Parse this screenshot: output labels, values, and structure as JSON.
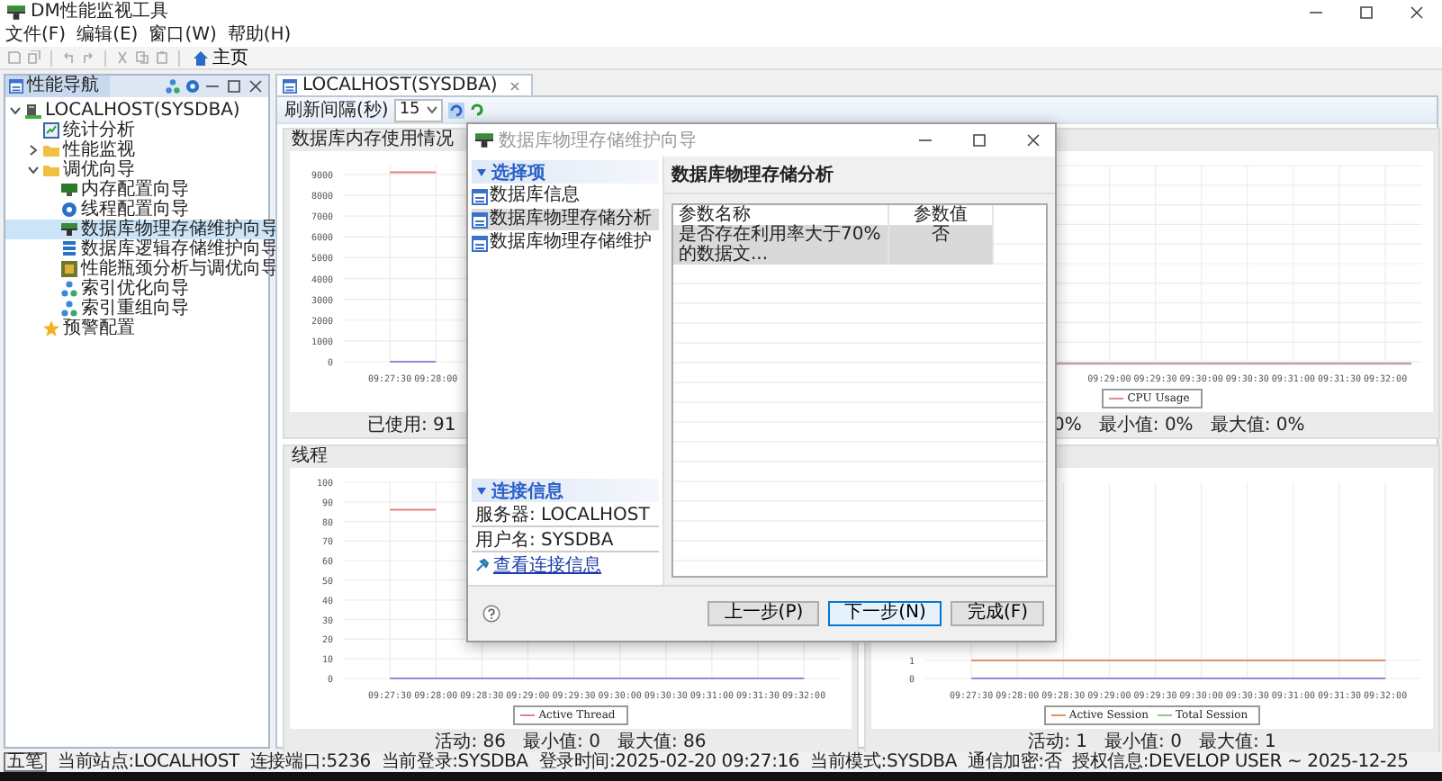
{
  "window": {
    "title": "DM性能监视工具"
  },
  "menu": [
    "文件(F)",
    "编辑(E)",
    "窗口(W)",
    "帮助(H)"
  ],
  "toolbar": {
    "home": "主页"
  },
  "navigator": {
    "title": "性能导航",
    "tree": [
      {
        "label": "LOCALHOST(SYSDBA)",
        "kind": "server",
        "expanded": true,
        "selected": false,
        "children": [
          {
            "label": "统计分析",
            "kind": "chart",
            "selected": false
          },
          {
            "label": "性能监视",
            "kind": "folder",
            "expanded": false,
            "selected": false
          },
          {
            "label": "调优向导",
            "kind": "folder",
            "expanded": true,
            "selected": false,
            "children": [
              {
                "label": "内存配置向导",
                "kind": "monitor",
                "selected": false
              },
              {
                "label": "线程配置向导",
                "kind": "gear",
                "selected": false
              },
              {
                "label": "数据库物理存储维护向导",
                "kind": "toolbox",
                "selected": true
              },
              {
                "label": "数据库逻辑存储维护向导",
                "kind": "stack",
                "selected": false
              },
              {
                "label": "性能瓶颈分析与调优向导",
                "kind": "grid",
                "selected": false
              },
              {
                "label": "索引优化向导",
                "kind": "hierarchy",
                "selected": false
              },
              {
                "label": "索引重组向导",
                "kind": "hierarchy",
                "selected": false
              }
            ]
          },
          {
            "label": "预警配置",
            "kind": "star",
            "selected": false
          }
        ]
      }
    ]
  },
  "editor_tab": {
    "label": "LOCALHOST(SYSDBA)",
    "selected": true
  },
  "refresh": {
    "label": "刷新间隔(秒)",
    "value": "15"
  },
  "panels": [
    {
      "title": "数据库内存使用情况",
      "stats": "已使用: 91",
      "chart_data": {
        "type": "line",
        "grid": true,
        "categories": [
          "09:27:30",
          "09:28:00"
        ],
        "ylim": [
          0,
          9430
        ],
        "yticks": [
          0,
          1000,
          2000,
          3000,
          4000,
          5000,
          6000,
          7000,
          8000,
          9000
        ],
        "series": [
          {
            "color": "#e88080",
            "values": [
              9100,
              9100
            ]
          },
          {
            "color": "#8c8cd8",
            "values": [
              0,
              0
            ]
          }
        ]
      }
    },
    {
      "stats": "0%   最小值: 0%   最大值: 0%",
      "chart": {
        "kind": "picture",
        "x_labels": [
          "09:29:00",
          "09:29:30",
          "09:30:00",
          "09:30:30",
          "09:31:00",
          "09:31:30",
          "09:32:00"
        ],
        "legend": [
          {
            "name": "CPU Usage",
            "color": "#d89090"
          }
        ]
      }
    },
    {
      "title": "线程",
      "stats": "活动: 86   最小值: 0   最大值: 86",
      "chart_data": {
        "type": "line",
        "grid": true,
        "categories": [
          "09:27:30",
          "09:28:00",
          "09:28:30",
          "09:29:00",
          "09:29:30",
          "09:30:00",
          "09:30:30",
          "09:31:00",
          "09:31:30",
          "09:32:00"
        ],
        "ylim": [
          0,
          100
        ],
        "yticks": [
          0,
          10,
          20,
          30,
          40,
          50,
          60,
          70,
          80,
          90,
          100
        ],
        "series": [
          {
            "name": "Active Thread",
            "color": "#e88080",
            "values": [
              86,
              86,
              null,
              null,
              null,
              null,
              null,
              null,
              null,
              null
            ]
          },
          {
            "color": "#8c8cd8",
            "values": [
              0,
              0,
              0,
              0,
              0,
              0,
              0,
              0,
              0,
              0
            ]
          }
        ]
      }
    },
    {
      "stats": "活动: 1   最小值: 0   最大值: 1",
      "chart_data": {
        "type": "line",
        "grid": true,
        "categories": [
          "09:27:30",
          "09:28:00",
          "09:28:30",
          "09:29:00",
          "09:29:30",
          "09:30:00",
          "09:30:30",
          "09:31:00",
          "09:31:30",
          "09:32:00"
        ],
        "ylim": [
          0,
          10.9
        ],
        "yticks": [
          0,
          1
        ],
        "series": [
          {
            "name": "Active Session",
            "color": "#e0906a",
            "values": [
              1,
              1,
              1,
              1,
              1,
              1,
              1,
              1,
              1,
              1
            ]
          },
          {
            "name": "Total Session",
            "color": "#90c890",
            "values": [
              null,
              null,
              null,
              null,
              null,
              null,
              null,
              null,
              null,
              null
            ]
          },
          {
            "color": "#8c8cd8",
            "values": [
              0,
              0,
              0,
              0,
              0,
              0,
              0,
              0,
              0,
              0
            ]
          }
        ]
      }
    }
  ],
  "dialog": {
    "title": "数据库物理存储维护向导",
    "steps_header": "选择项",
    "steps": [
      {
        "label": "数据库信息",
        "selected": false
      },
      {
        "label": "数据库物理存储分析",
        "selected": true
      },
      {
        "label": "数据库物理存储维护",
        "selected": false
      }
    ],
    "connection_header": "连接信息",
    "connection": [
      "服务器: LOCALHOST",
      "用户名: SYSDBA"
    ],
    "link": "查看连接信息",
    "page_title": "数据库物理存储分析",
    "table": {
      "columns": [
        "参数名称",
        "参数值"
      ],
      "rows": [
        {
          "cells": [
            "是否存在利用率大于70%的数据文...",
            "否"
          ],
          "selected": true
        }
      ]
    },
    "buttons": [
      {
        "label": "上一步(P)",
        "default": false
      },
      {
        "label": "下一步(N)",
        "default": true
      },
      {
        "label": "完成(F)",
        "default": false
      }
    ]
  },
  "status_bar": {
    "ime": "五笔",
    "items": [
      "当前站点:LOCALHOST",
      "连接端口:5236",
      "当前登录:SYSDBA",
      "登录时间:2025-02-20 09:27:16",
      "当前模式:SYSDBA",
      "通信加密:否",
      "授权信息:DEVELOP USER ~ 2025-12-25"
    ]
  }
}
